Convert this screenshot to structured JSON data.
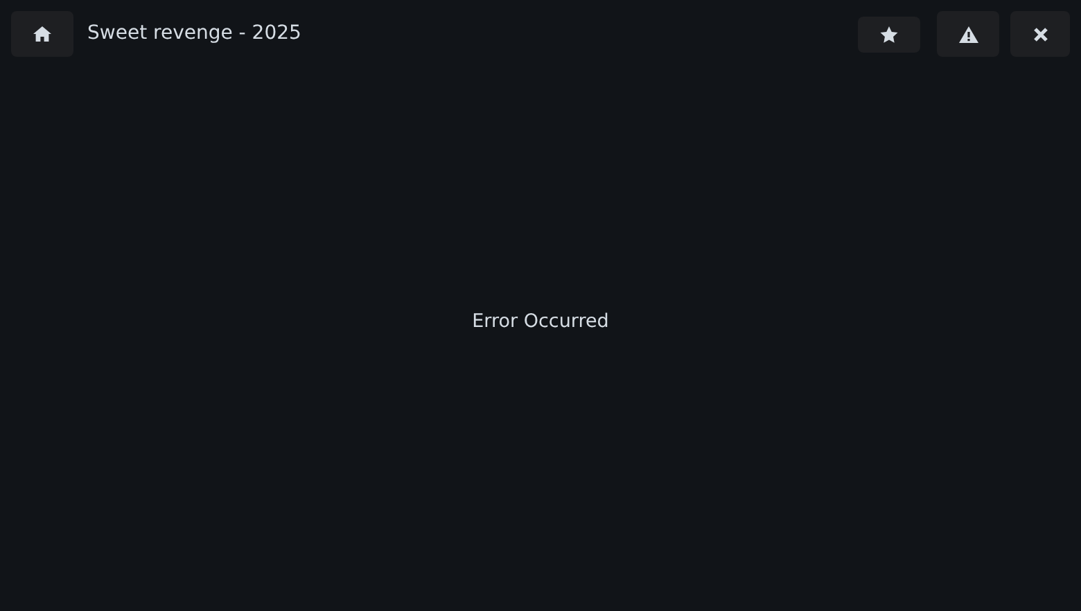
{
  "header": {
    "title": "Sweet revenge - 2025"
  },
  "message": "Error Occurred"
}
